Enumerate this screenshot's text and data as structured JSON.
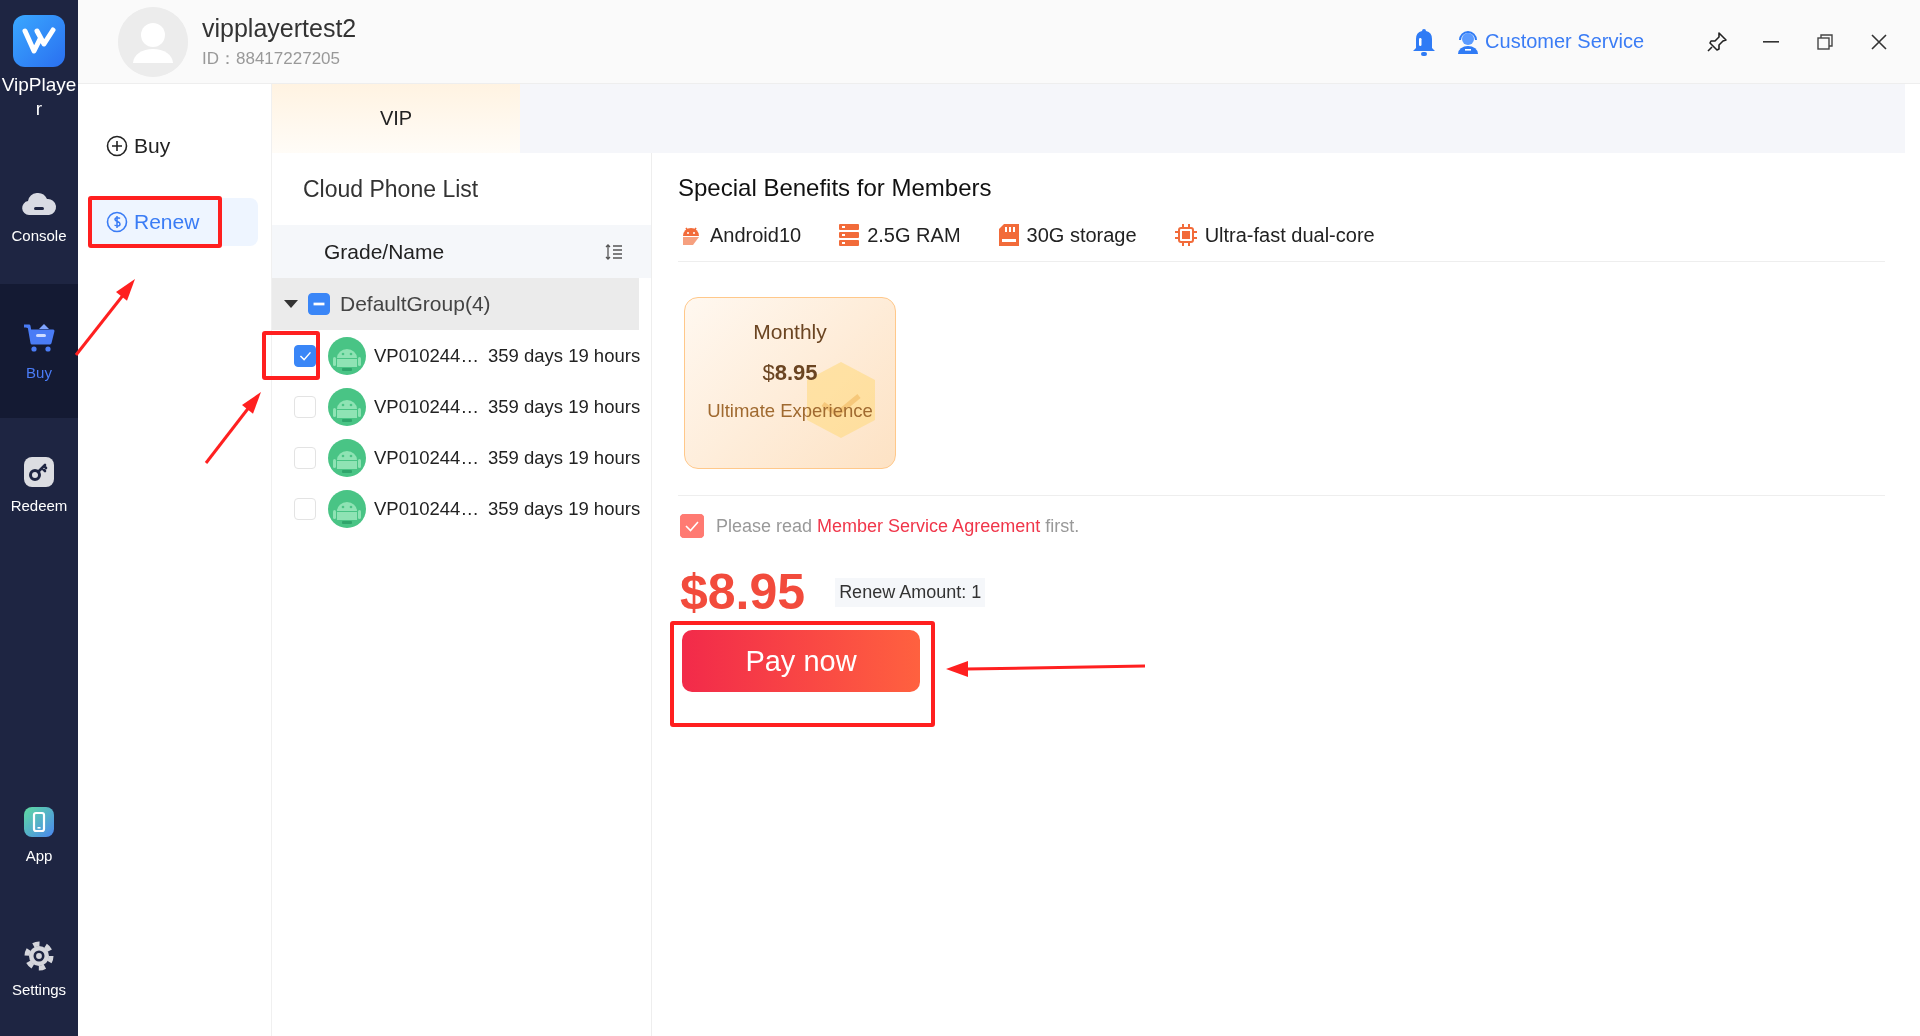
{
  "app": {
    "name": "VipPlayer"
  },
  "rail": [
    {
      "kind": "console",
      "label": "Console",
      "selected": false
    },
    {
      "kind": "buy",
      "label": "Buy",
      "selected": true
    },
    {
      "kind": "redeem",
      "label": "Redeem",
      "selected": false
    },
    {
      "kind": "app",
      "label": "App",
      "selected": false
    },
    {
      "kind": "settings",
      "label": "Settings",
      "selected": false
    }
  ],
  "user": {
    "name": "vipplayertest2",
    "id": "ID：88417227205"
  },
  "header": {
    "customer_service": "Customer Service"
  },
  "submenu": [
    {
      "kind": "buy",
      "label": "Buy",
      "selected": false
    },
    {
      "kind": "renew",
      "label": "Renew",
      "selected": true
    }
  ],
  "tabs": [
    {
      "label": "VIP",
      "selected": true
    }
  ],
  "phone_list": {
    "title": "Cloud Phone List",
    "column": "Grade/Name",
    "group": {
      "label": "DefaultGroup(4)",
      "expanded": true,
      "indeterminate": true
    },
    "devices": [
      {
        "name": "VP010244…",
        "remaining": "359 days 19 hours",
        "checked": true
      },
      {
        "name": "VP010244…",
        "remaining": "359 days 19 hours",
        "checked": false
      },
      {
        "name": "VP010244…",
        "remaining": "359 days 19 hours",
        "checked": false
      },
      {
        "name": "VP010244…",
        "remaining": "359 days 19 hours",
        "checked": false
      }
    ]
  },
  "benefits": {
    "title": "Special Benefits for Members",
    "features": [
      {
        "kind": "android",
        "label": "Android10"
      },
      {
        "kind": "ram",
        "label": "2.5G RAM"
      },
      {
        "kind": "storage",
        "label": "30G storage"
      },
      {
        "kind": "cpu",
        "label": "Ultra-fast dual-core"
      }
    ]
  },
  "plans": [
    {
      "name": "Monthly",
      "price": "$**8.95**",
      "note": "Ultimate Experience",
      "selected": true
    }
  ],
  "agreement": {
    "checked": true,
    "before": "Please read ",
    "link": "Member Service Agreement",
    "after": " first."
  },
  "total": "$8.95",
  "renew_amount": "Renew Amount: 1",
  "pay_button": "Pay now"
}
